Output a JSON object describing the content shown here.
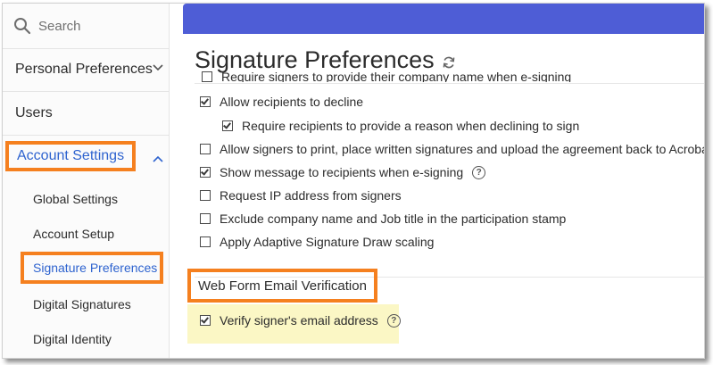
{
  "sidebar": {
    "search_placeholder": "Search",
    "personal_preferences": "Personal Preferences",
    "users": "Users",
    "account_settings": "Account Settings",
    "sub_items": {
      "global_settings": "Global Settings",
      "account_setup": "Account Setup",
      "signature_preferences": "Signature Preferences",
      "digital_signatures": "Digital Signatures",
      "digital_identity": "Digital Identity"
    }
  },
  "main": {
    "title": "Signature Preferences",
    "partial_option": "Require signers to provide their company name when e-signing",
    "options": [
      {
        "label": "Allow recipients to decline",
        "checked": true
      },
      {
        "label": "Require recipients to provide a reason when declining to sign",
        "checked": true
      },
      {
        "label": "Allow signers to print, place written signatures and upload the agreement back to Acrobat Sign",
        "checked": false
      },
      {
        "label": "Show message to recipients when e-signing",
        "checked": true
      },
      {
        "label": "Request IP address from signers",
        "checked": false
      },
      {
        "label": "Exclude company name and Job title in the participation stamp",
        "checked": false
      },
      {
        "label": "Apply Adaptive Signature Draw scaling",
        "checked": false
      }
    ],
    "web_form_section": {
      "heading": "Web Form Email Verification",
      "verify_label": "Verify signer's email address",
      "verify_checked": true
    },
    "help_glyph": "?"
  },
  "colors": {
    "accent_blue": "#4e5dd6",
    "link_blue": "#2e63cf",
    "callout_orange": "#f5801f",
    "highlight_yellow": "#fbf7c5"
  },
  "icons": [
    "search-icon",
    "chevron-down-icon",
    "chevron-up-icon",
    "refresh-icon",
    "help-icon"
  ]
}
